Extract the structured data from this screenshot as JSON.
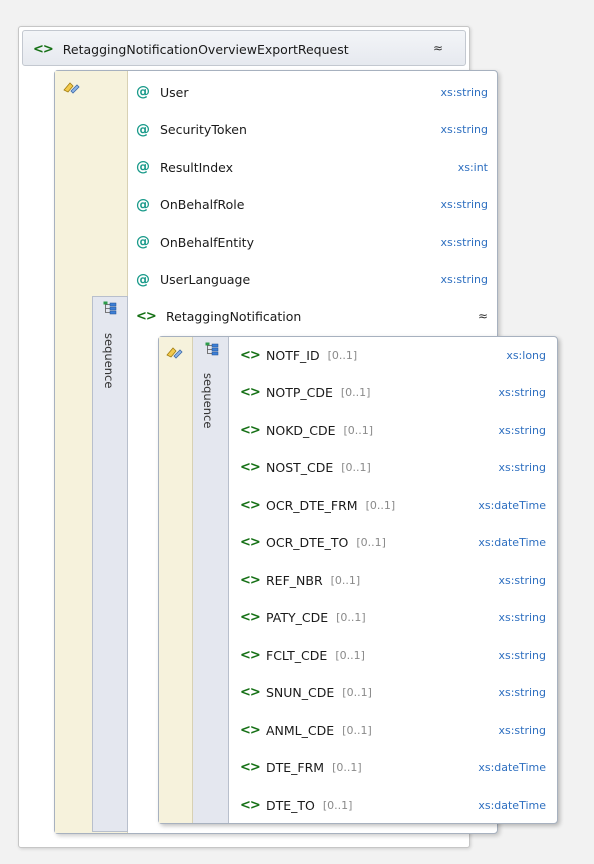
{
  "root": {
    "name": "RetaggingNotificationOverviewExportRequest",
    "collapse_symbol": "≈"
  },
  "attributes": [
    {
      "name": "User",
      "type": "xs:string"
    },
    {
      "name": "SecurityToken",
      "type": "xs:string"
    },
    {
      "name": "ResultIndex",
      "type": "xs:int"
    },
    {
      "name": "OnBehalfRole",
      "type": "xs:string"
    },
    {
      "name": "OnBehalfEntity",
      "type": "xs:string"
    },
    {
      "name": "UserLanguage",
      "type": "xs:string"
    }
  ],
  "sequence_label": "sequence",
  "child": {
    "name": "RetaggingNotification",
    "collapse_symbol": "≈"
  },
  "inner_sequence_label": "sequence",
  "elements": [
    {
      "name": "NOTF_ID",
      "occurs": "[0..1]",
      "type": "xs:long"
    },
    {
      "name": "NOTP_CDE",
      "occurs": "[0..1]",
      "type": "xs:string"
    },
    {
      "name": "NOKD_CDE",
      "occurs": "[0..1]",
      "type": "xs:string"
    },
    {
      "name": "NOST_CDE",
      "occurs": "[0..1]",
      "type": "xs:string"
    },
    {
      "name": "OCR_DTE_FRM",
      "occurs": "[0..1]",
      "type": "xs:dateTime"
    },
    {
      "name": "OCR_DTE_TO",
      "occurs": "[0..1]",
      "type": "xs:dateTime"
    },
    {
      "name": "REF_NBR",
      "occurs": "[0..1]",
      "type": "xs:string"
    },
    {
      "name": "PATY_CDE",
      "occurs": "[0..1]",
      "type": "xs:string"
    },
    {
      "name": "FCLT_CDE",
      "occurs": "[0..1]",
      "type": "xs:string"
    },
    {
      "name": "SNUN_CDE",
      "occurs": "[0..1]",
      "type": "xs:string"
    },
    {
      "name": "ANML_CDE",
      "occurs": "[0..1]",
      "type": "xs:string"
    },
    {
      "name": "DTE_FRM",
      "occurs": "[0..1]",
      "type": "xs:dateTime"
    },
    {
      "name": "DTE_TO",
      "occurs": "[0..1]",
      "type": "xs:dateTime"
    }
  ],
  "icons": {
    "element": "element-icon",
    "attribute": "attribute-icon",
    "sequence": "sequence-icon",
    "complex_type": "complex-type-icon"
  },
  "colors": {
    "element_icon": "#157015",
    "attribute_icon": "#1a9a8a",
    "type_text": "#2e6fc0",
    "complex_strip": "#f6f2dc",
    "sequence_bg": "#e4e7ef"
  }
}
